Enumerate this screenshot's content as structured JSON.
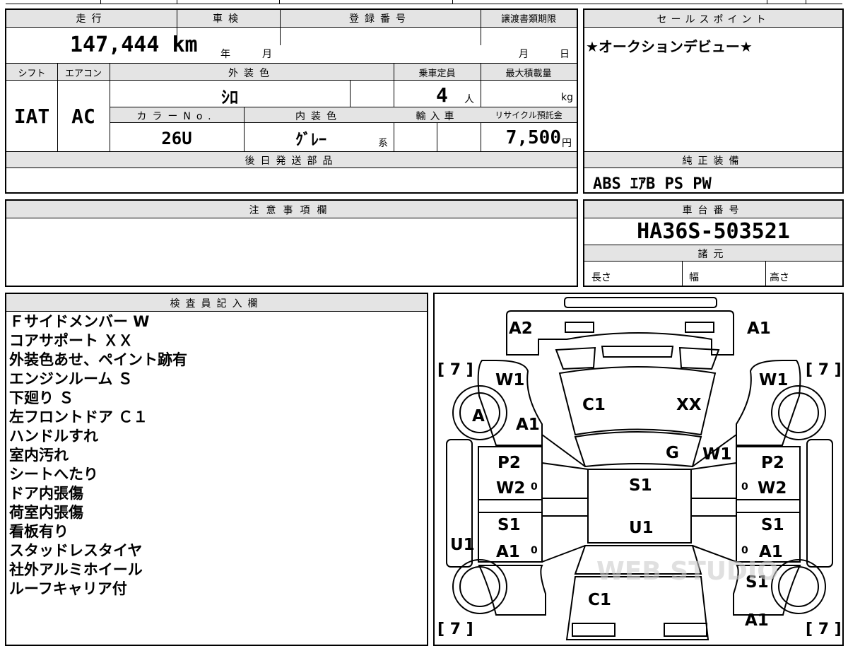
{
  "vehicle": {
    "mileage_label": "走行",
    "mileage": "147,444",
    "mileage_unit": "km",
    "inspection_label": "車検",
    "inspection_year": "年",
    "inspection_month": "月",
    "registration_label": "登録番号",
    "transfer_label": "譲渡書類期限",
    "transfer_month": "月",
    "transfer_day": "日",
    "shift_label": "シフト",
    "shift": "IAT",
    "ac_label": "エアコン",
    "ac": "AC",
    "exterior_label": "外装色",
    "exterior": "ｼﾛ",
    "capacity_label": "乗車定員",
    "capacity": "4",
    "capacity_unit": "人",
    "max_load_label": "最大積載量",
    "max_load_unit": "kg",
    "color_no_label": "カラーNo.",
    "color_no": "26U",
    "interior_label": "内装色",
    "interior": "ｸﾞﾚｰ",
    "interior_suffix": "系",
    "import_label": "輸入車",
    "recycle_label": "リサイクル預託金",
    "recycle": "7,500",
    "recycle_unit": "円",
    "later_parts_label": "後日発送部品"
  },
  "sales": {
    "label": "セールスポイント",
    "text": "★オークションデビュー★"
  },
  "equipment": {
    "label": "純正装備",
    "text": "ABS ｴｱB PS PW"
  },
  "caution": {
    "label": "注意事項欄"
  },
  "chassis": {
    "label": "車台番号",
    "number": "HA36S-503521",
    "specs_label": "諸元",
    "length": "長さ",
    "width": "幅",
    "height": "高さ"
  },
  "inspector": {
    "label": "検査員記入欄",
    "notes": [
      "Ｆサイドメンバー W",
      "コアサポート ＸＸ",
      "外装色あせ、ペイント跡有",
      "エンジンルーム Ｓ",
      "下廻り Ｓ",
      "左フロントドア Ｃ１",
      "ハンドルすれ",
      "室内汚れ",
      "シートへたり",
      "ドア内張傷",
      "荷室内張傷",
      "看板有り",
      "スタッドレスタイヤ",
      "社外アルミホイール",
      "ルーフキャリア付"
    ]
  },
  "diagram": {
    "marks": [
      "A2",
      "A1",
      "W1",
      "W1",
      "C1",
      "XX",
      "A",
      "A1",
      "G",
      "W1",
      "P2",
      "W2",
      "S1",
      "P2",
      "W2",
      "U1",
      "S1",
      "A1",
      "S1",
      "A1",
      "U1",
      "S1",
      "C1",
      "A1"
    ],
    "tire_marks": [
      "[ 7 ]",
      "[ 7 ]",
      "[ 7 ]",
      "[ 7 ]"
    ],
    "zeros": [
      "0",
      "0",
      "0",
      "0"
    ],
    "watermark": "WEB STUDIO"
  }
}
